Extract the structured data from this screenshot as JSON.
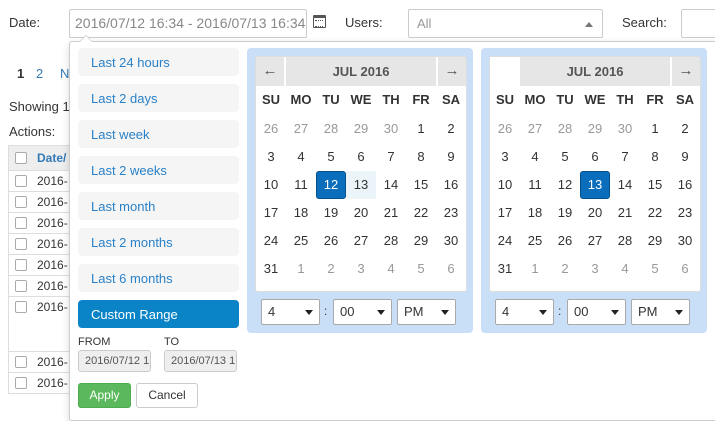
{
  "filters": {
    "date_label": "Date:",
    "date_value": "2016/07/12 16:34 - 2016/07/13 16:34",
    "users_label": "Users:",
    "users_value": "All",
    "search_label": "Search:"
  },
  "background": {
    "pager": [
      "1",
      "2",
      "N"
    ],
    "showing": "Showing 1",
    "actions": "Actions:",
    "table_header": "Date/",
    "rows": [
      "2016-",
      "2016-",
      "2016-",
      "2016-",
      "2016-",
      "2016-",
      "2016-",
      "2016-",
      "2016-"
    ]
  },
  "ranges": {
    "items": [
      "Last 24 hours",
      "Last 2 days",
      "Last week",
      "Last 2 weeks",
      "Last month",
      "Last 2 months",
      "Last 6 months",
      "Custom Range"
    ],
    "active_index": 7,
    "from_label": "FROM",
    "to_label": "TO",
    "from_value": "2016/07/12 1",
    "to_value": "2016/07/13 1",
    "apply_label": "Apply",
    "cancel_label": "Cancel"
  },
  "calendars": [
    {
      "month": "JUL 2016",
      "show_prev": true,
      "show_next": true,
      "selected_day": "12",
      "hour": "4",
      "minute": "00",
      "ampm": "PM"
    },
    {
      "month": "JUL 2016",
      "show_prev": false,
      "show_next": true,
      "selected_day": "13",
      "hour": "4",
      "minute": "00",
      "ampm": "PM"
    }
  ],
  "weekdays": [
    "SU",
    "MO",
    "TU",
    "WE",
    "TH",
    "FR",
    "SA"
  ],
  "weeks": [
    [
      "26",
      "27",
      "28",
      "29",
      "30",
      "1",
      "2"
    ],
    [
      "3",
      "4",
      "5",
      "6",
      "7",
      "8",
      "9"
    ],
    [
      "10",
      "11",
      "12",
      "13",
      "14",
      "15",
      "16"
    ],
    [
      "17",
      "18",
      "19",
      "20",
      "21",
      "22",
      "23"
    ],
    [
      "24",
      "25",
      "26",
      "27",
      "28",
      "29",
      "30"
    ],
    [
      "31",
      "1",
      "2",
      "3",
      "4",
      "5",
      "6"
    ]
  ],
  "colors": {
    "accent": "#0a84c6",
    "selected_day": "#0a6ebd",
    "apply": "#5cb85c",
    "calendar_frame": "#c9dff7"
  }
}
